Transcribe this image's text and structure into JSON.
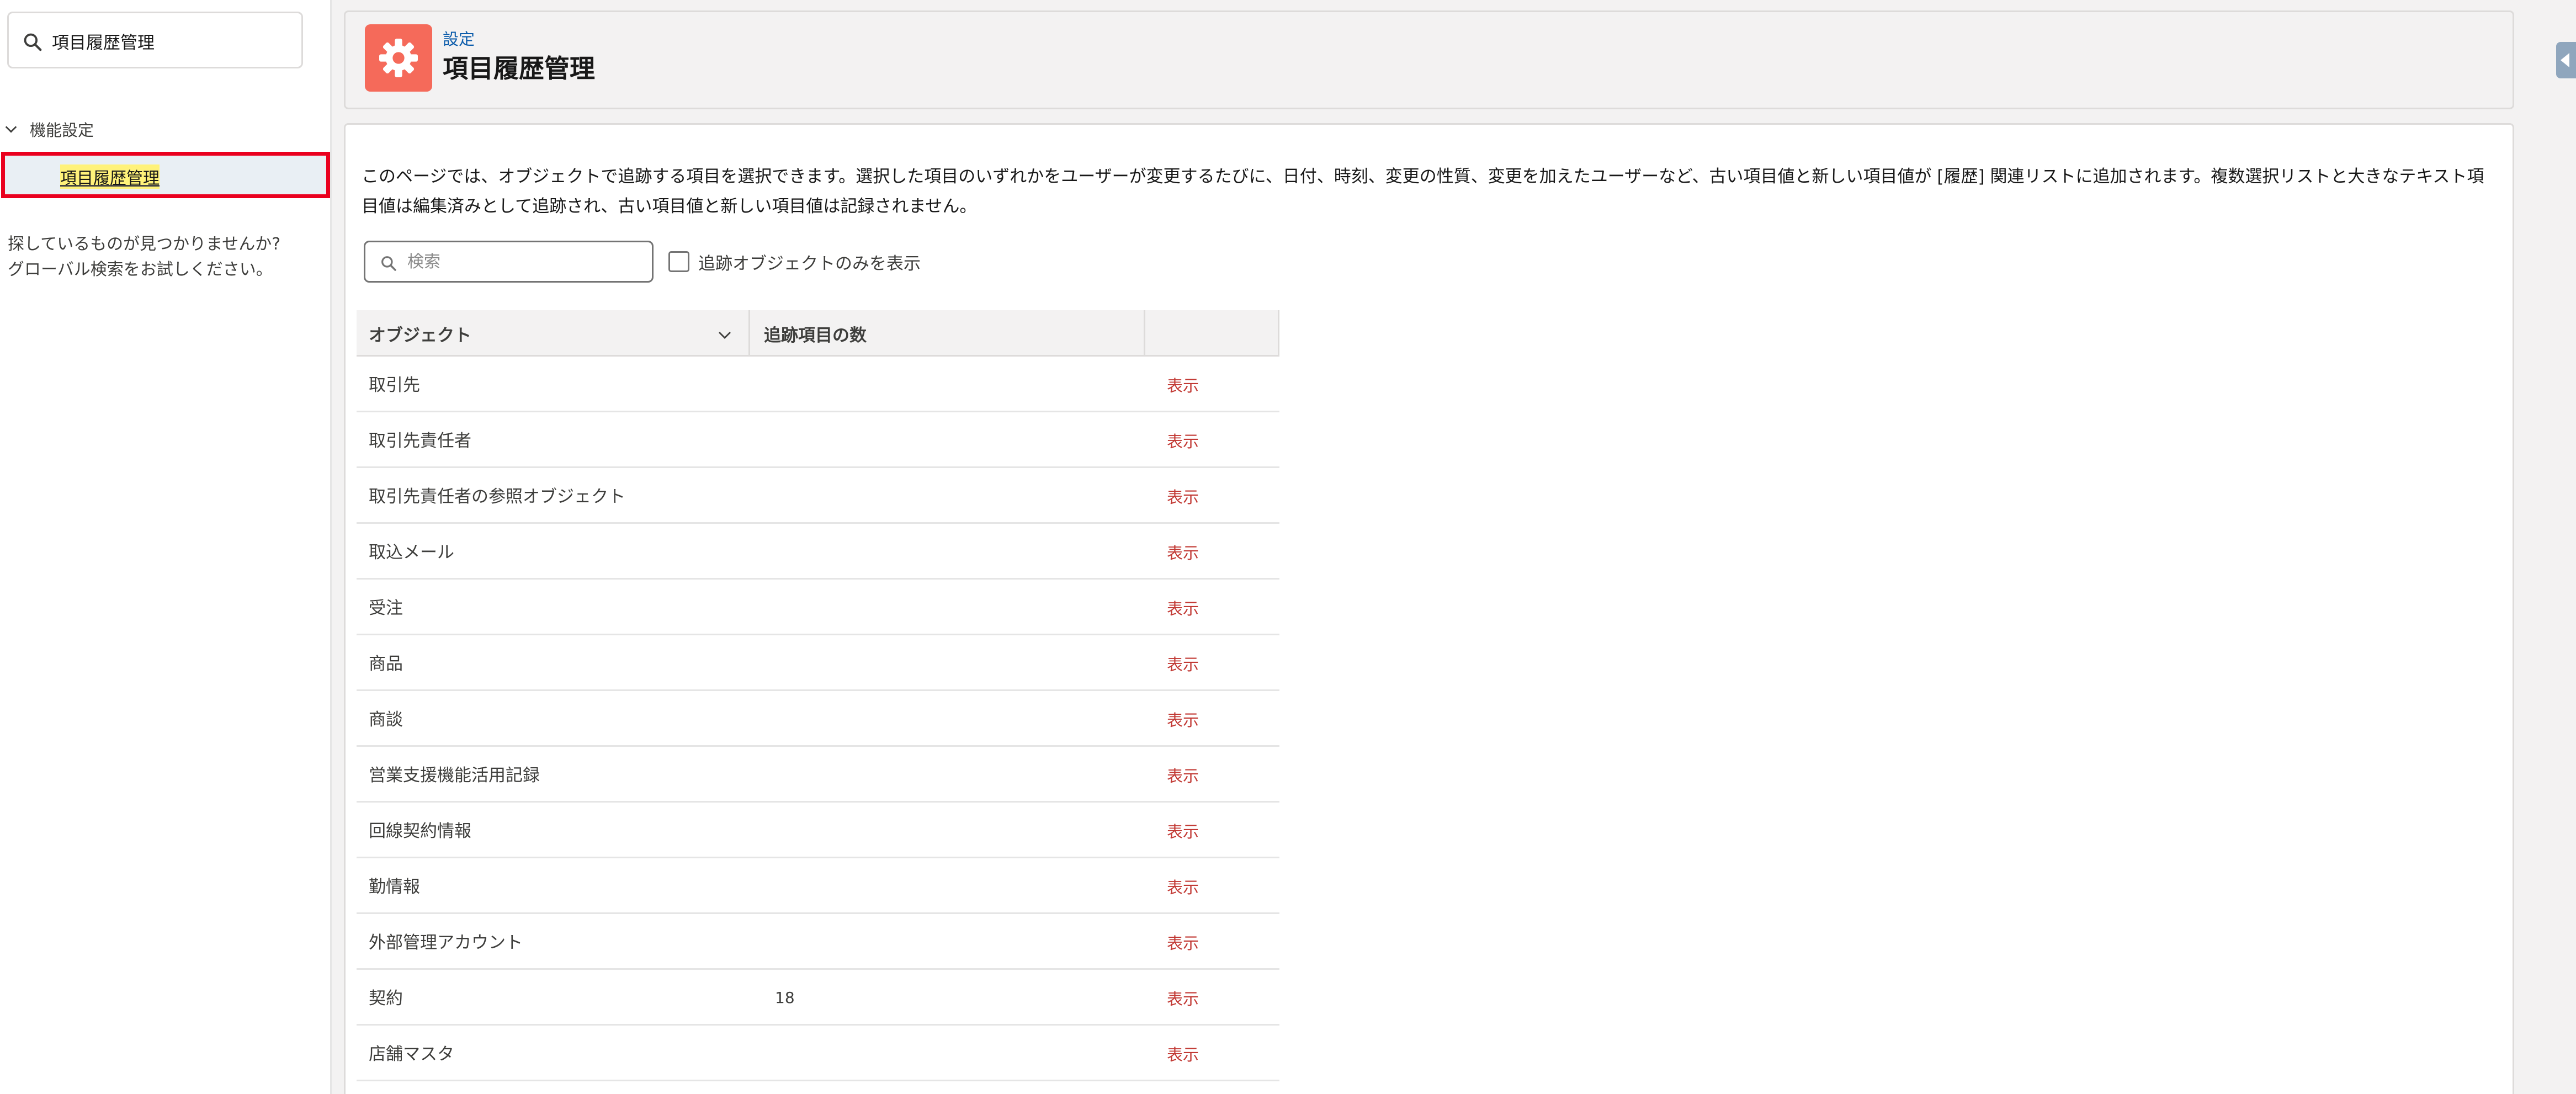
{
  "sidebar": {
    "quickfind_value": "項目履歴管理",
    "group_label": "機能設定",
    "selected_item": "項目履歴管理",
    "not_found_line1": "探しているものが見つかりませんか?",
    "not_found_line2": "グローバル検索をお試しください。"
  },
  "header": {
    "breadcrumb": "設定",
    "title": "項目履歴管理",
    "icon": "gear-icon",
    "icon_bg": "#f56a5a"
  },
  "main": {
    "description": "このページでは、オブジェクトで追跡する項目を選択できます。選択した項目のいずれかをユーザーが変更するたびに、日付、時刻、変更の性質、変更を加えたユーザーなど、古い項目値と新しい項目値が [履歴] 関連リストに追加されます。複数選択リストと大きなテキスト項目値は編集済みとして追跡され、古い項目値と新しい項目値は記録されません。",
    "search_placeholder": "検索",
    "checkbox_label": "追跡オブジェクトのみを表示"
  },
  "table": {
    "headers": {
      "object": "オブジェクト",
      "count": "追跡項目の数"
    },
    "rows": [
      {
        "object": "取引先",
        "count": "",
        "action": "表示"
      },
      {
        "object": "取引先責任者",
        "count": "",
        "action": "表示"
      },
      {
        "object": "取引先責任者の参照オブジェクト",
        "count": "",
        "action": "表示"
      },
      {
        "object": "取込メール",
        "count": "",
        "action": "表示"
      },
      {
        "object": "受注",
        "count": "",
        "action": "表示"
      },
      {
        "object": "商品",
        "count": "",
        "action": "表示"
      },
      {
        "object": "商談",
        "count": "",
        "action": "表示"
      },
      {
        "object": "営業支援機能活用記録",
        "count": "",
        "action": "表示"
      },
      {
        "object": "回線契約情報",
        "count": "",
        "action": "表示"
      },
      {
        "object": "勤情報",
        "count": "",
        "action": "表示"
      },
      {
        "object": "外部管理アカウント",
        "count": "",
        "action": "表示"
      },
      {
        "object": "契約",
        "count": "18",
        "action": "表示"
      },
      {
        "object": "店舗マスタ",
        "count": "",
        "action": "表示"
      }
    ]
  },
  "colors": {
    "link_red": "#c23934",
    "highlight_border": "#ea001e",
    "breadcrumb_blue": "#0b5cab"
  }
}
